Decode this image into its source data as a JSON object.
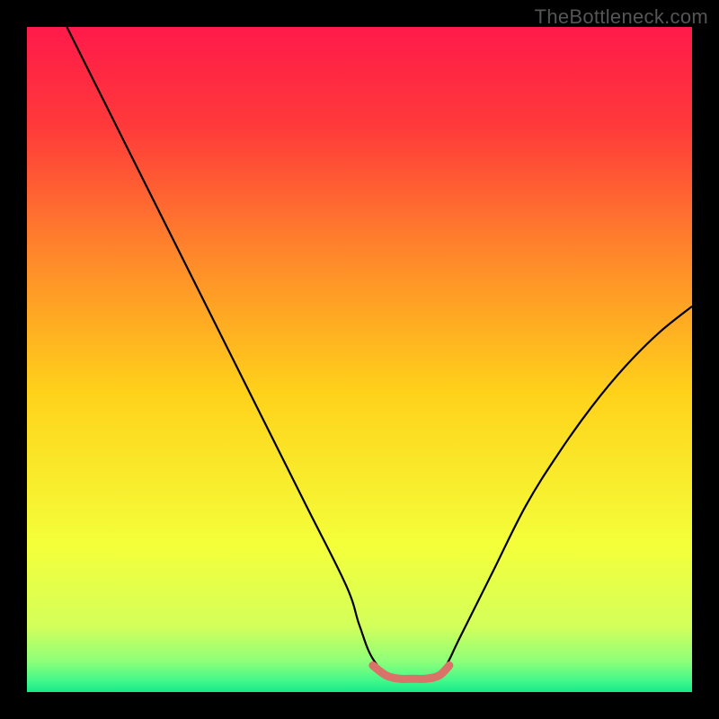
{
  "watermark": "TheBottleneck.com",
  "chart_data": {
    "type": "line",
    "title": "",
    "xlabel": "",
    "ylabel": "",
    "xlim": [
      0,
      100
    ],
    "ylim": [
      0,
      100
    ],
    "series": [
      {
        "name": "curve",
        "color": "#000000",
        "x": [
          6,
          12,
          18,
          24,
          30,
          36,
          42,
          48,
          50,
          52,
          55,
          58,
          61,
          63,
          65,
          70,
          75,
          80,
          85,
          90,
          95,
          100
        ],
        "y": [
          100,
          88,
          76,
          64,
          52,
          40,
          28,
          16,
          10,
          5,
          2,
          2,
          2,
          4,
          8,
          18,
          28,
          36,
          43,
          49,
          54,
          58
        ]
      },
      {
        "name": "highlight-segment",
        "color": "#d9736a",
        "x": [
          52,
          54,
          56,
          58,
          60,
          62,
          63.5
        ],
        "y": [
          4,
          2.5,
          2,
          2,
          2,
          2.5,
          4
        ]
      }
    ],
    "background_gradient": {
      "stops": [
        {
          "offset": 0.0,
          "color": "#ff1a4a"
        },
        {
          "offset": 0.15,
          "color": "#ff3a3a"
        },
        {
          "offset": 0.35,
          "color": "#ff8a2a"
        },
        {
          "offset": 0.55,
          "color": "#ffd21a"
        },
        {
          "offset": 0.78,
          "color": "#f4ff3a"
        },
        {
          "offset": 0.9,
          "color": "#d4ff5a"
        },
        {
          "offset": 0.955,
          "color": "#8cff7a"
        },
        {
          "offset": 0.985,
          "color": "#3cf78a"
        },
        {
          "offset": 1.0,
          "color": "#18e888"
        }
      ]
    }
  }
}
